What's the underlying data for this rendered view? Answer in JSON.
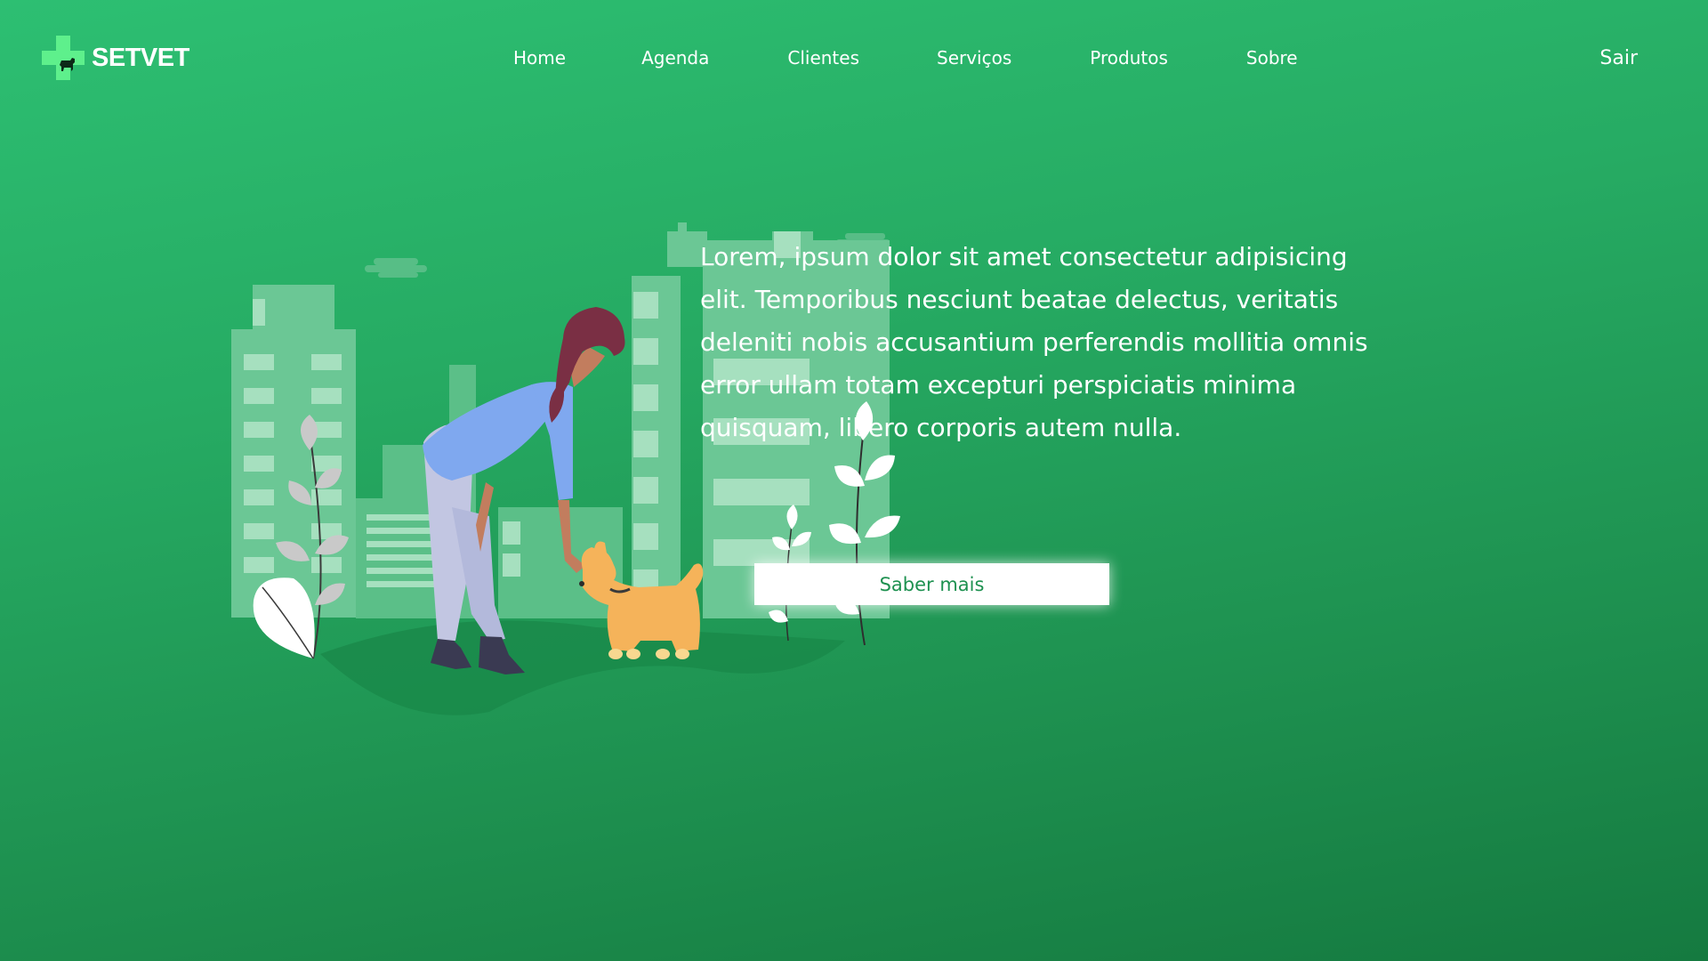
{
  "brand": {
    "name": "SETVET",
    "logo_icon": "vet-cross-dog-icon"
  },
  "nav": {
    "items": [
      {
        "label": "Home"
      },
      {
        "label": "Agenda"
      },
      {
        "label": "Clientes"
      },
      {
        "label": "Serviços"
      },
      {
        "label": "Produtos"
      },
      {
        "label": "Sobre"
      }
    ],
    "logout_label": "Sair"
  },
  "hero": {
    "text": "Lorem, ipsum dolor sit amet consectetur adipisicing elit. Temporibus nesciunt beatae delectus, veritatis deleniti nobis accusantium perferendis mollitia omnis error ullam totam excepturi perspiciatis minima quisquam, libero corporis autem nulla.",
    "cta_label": "Saber mais",
    "illustration": "woman-petting-dog-city-illustration"
  },
  "colors": {
    "background_top": "#2dbf72",
    "background_bottom": "#157a40",
    "accent": "#1e9150",
    "logo_cross": "#5ef08c",
    "dog": "#f5b35a",
    "shirt": "#7fa8ef"
  }
}
